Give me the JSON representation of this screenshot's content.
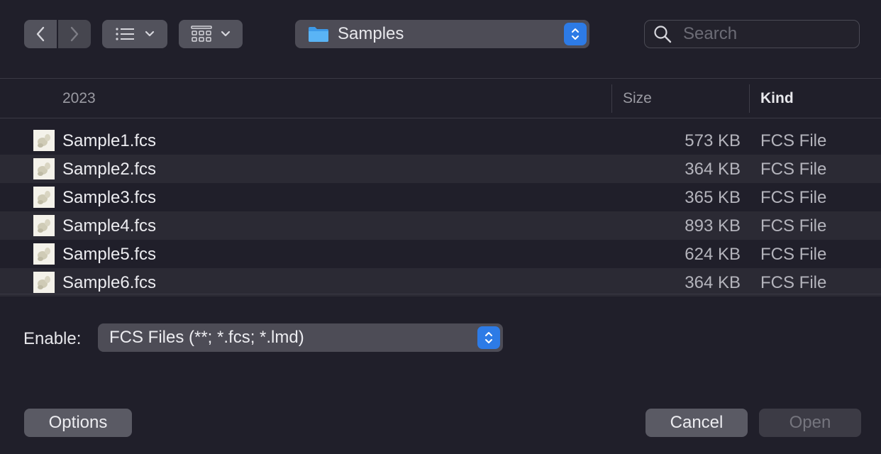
{
  "toolbar": {
    "back_icon": "chevron-left-icon",
    "forward_icon": "chevron-right-icon",
    "view_icon": "list-view-icon",
    "group_icon": "group-grid-icon",
    "location": {
      "label": "Samples",
      "icon": "folder-icon",
      "icon_color": "#43a4f0"
    },
    "search": {
      "placeholder": "Search",
      "value": ""
    }
  },
  "list": {
    "columns": {
      "name": "2023",
      "size": "Size",
      "kind": "Kind"
    },
    "files": [
      {
        "name": "Sample1.fcs",
        "size": "573 KB",
        "kind": "FCS File"
      },
      {
        "name": "Sample2.fcs",
        "size": "364 KB",
        "kind": "FCS File"
      },
      {
        "name": "Sample3.fcs",
        "size": "365 KB",
        "kind": "FCS File"
      },
      {
        "name": "Sample4.fcs",
        "size": "893 KB",
        "kind": "FCS File"
      },
      {
        "name": "Sample5.fcs",
        "size": "624 KB",
        "kind": "FCS File"
      },
      {
        "name": "Sample6.fcs",
        "size": "364 KB",
        "kind": "FCS File"
      }
    ]
  },
  "filter": {
    "label": "Enable:",
    "selected": "FCS Files (**; *.fcs; *.lmd)"
  },
  "buttons": {
    "options": "Options",
    "cancel": "Cancel",
    "open": "Open"
  },
  "colors": {
    "background": "#201f2a",
    "accent": "#2d7be6"
  }
}
